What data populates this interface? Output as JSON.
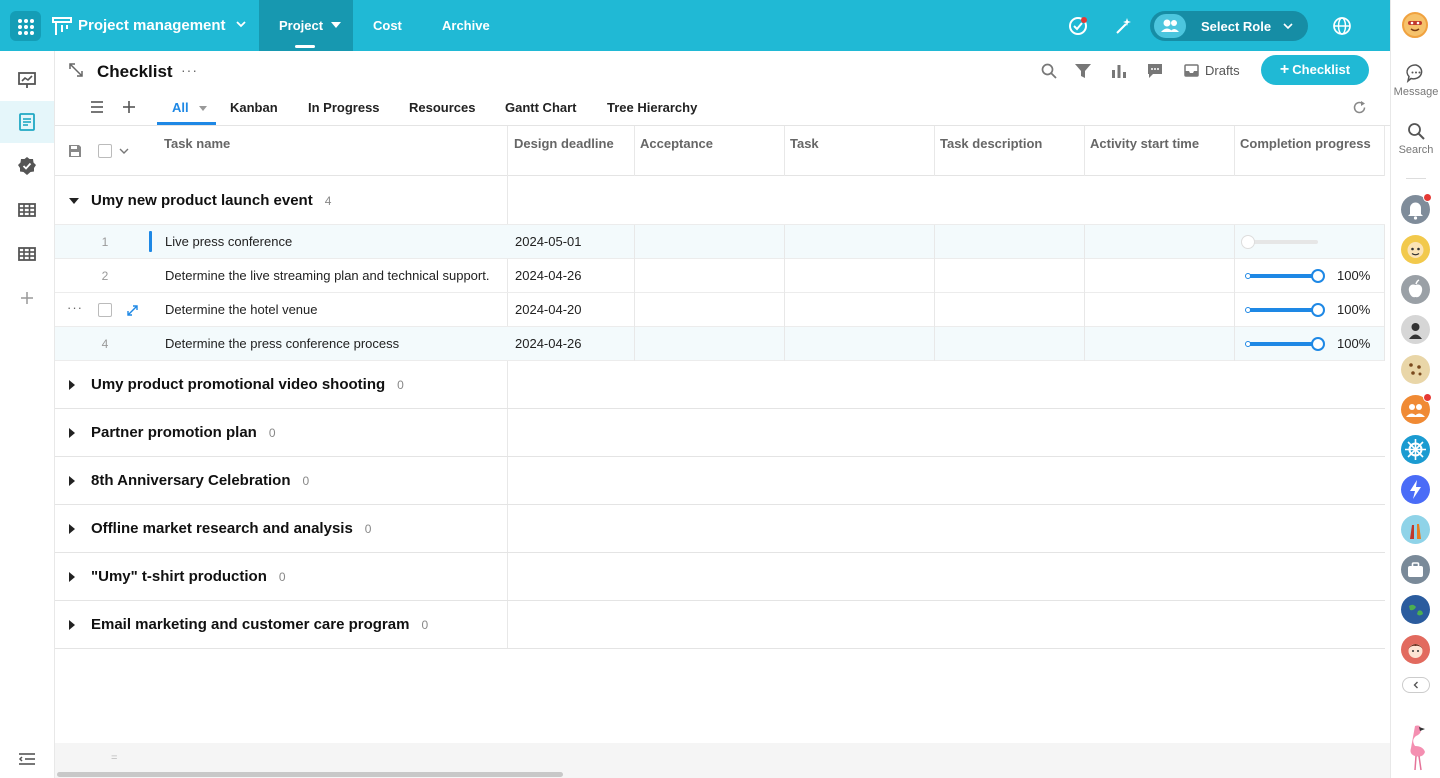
{
  "topbar": {
    "app_title": "Project management",
    "nav_tabs": [
      {
        "label": "Project",
        "active": true
      },
      {
        "label": "Cost",
        "active": false
      },
      {
        "label": "Archive",
        "active": false
      }
    ],
    "role_label": "Select Role",
    "icons": [
      "apps-grid-icon",
      "project-logo-icon",
      "chevron-down-icon",
      "check-badge-icon",
      "magic-wand-icon",
      "people-icon",
      "globe-icon"
    ],
    "accent_color": "#20b9d5"
  },
  "leftbar": {
    "items": [
      {
        "icon": "presentation-chart-icon",
        "active": false
      },
      {
        "icon": "document-list-icon",
        "active": true
      },
      {
        "icon": "verified-badge-icon",
        "active": false
      },
      {
        "icon": "table-grid-icon",
        "active": false
      },
      {
        "icon": "table-grid-icon",
        "active": false
      },
      {
        "icon": "plus-icon",
        "active": false
      }
    ],
    "bottom_icon": "collapse-menu-icon"
  },
  "header": {
    "title": "Checklist",
    "more": "···",
    "drafts_label": "Drafts",
    "new_button_label": "Checklist",
    "tool_icons": [
      "search-icon",
      "filter-icon",
      "bar-chart-icon",
      "comment-icon",
      "drafts-icon"
    ]
  },
  "view_tabs": [
    {
      "label": "All",
      "active": true
    },
    {
      "label": "Kanban",
      "active": false
    },
    {
      "label": "In Progress",
      "active": false
    },
    {
      "label": "Resources",
      "active": false
    },
    {
      "label": "Gantt Chart",
      "active": false
    },
    {
      "label": "Tree Hierarchy",
      "active": false
    }
  ],
  "table": {
    "columns": [
      "Task name",
      "Design deadline",
      "Acceptance",
      "Task",
      "Task description",
      "Activity start time",
      "Completion progress"
    ],
    "groups": [
      {
        "title": "Umy new product launch event",
        "count": "4",
        "expanded": true,
        "rows": [
          {
            "num": "1",
            "name": "Live press conference",
            "deadline": "2024-05-01",
            "progress": 0,
            "progress_text": ""
          },
          {
            "num": "2",
            "name": "Determine the live streaming plan and technical support.",
            "deadline": "2024-04-26",
            "progress": 1,
            "progress_text": "100%"
          },
          {
            "num": "",
            "name": "Determine the hotel venue",
            "deadline": "2024-04-20",
            "progress": 1,
            "progress_text": "100%"
          },
          {
            "num": "4",
            "name": "Determine the press conference process",
            "deadline": "2024-04-26",
            "progress": 1,
            "progress_text": "100%"
          }
        ]
      },
      {
        "title": "Umy product promotional video shooting",
        "count": "0",
        "expanded": false
      },
      {
        "title": "Partner promotion plan",
        "count": "0",
        "expanded": false
      },
      {
        "title": "8th Anniversary Celebration",
        "count": "0",
        "expanded": false
      },
      {
        "title": "Offline market research and analysis",
        "count": "0",
        "expanded": false
      },
      {
        "title": "\"Umy\" t-shirt production",
        "count": "0",
        "expanded": false
      },
      {
        "title": "Email marketing and customer care program",
        "count": "0",
        "expanded": false
      }
    ],
    "progress_color": "#1e88e5"
  },
  "footer": {
    "handle": "="
  },
  "rightbar": {
    "message_label": "Message",
    "search_label": "Search",
    "apps": [
      {
        "icon": "bell-icon",
        "color": "#7f8c9a",
        "badge": true
      },
      {
        "icon": "cartoon-avatar-icon",
        "color": "#f2c94c",
        "badge": false
      },
      {
        "icon": "apple-icon",
        "color": "#9aa0a6",
        "badge": false
      },
      {
        "icon": "character-icon",
        "color": "#d6d6d6",
        "badge": false
      },
      {
        "icon": "cookie-icon",
        "color": "#e9d6a8",
        "badge": false
      },
      {
        "icon": "team-icon",
        "color": "#f08a34",
        "badge": true
      },
      {
        "icon": "ship-wheel-icon",
        "color": "#1b9bd1",
        "badge": false
      },
      {
        "icon": "lightning-icon",
        "color": "#4a6cf7",
        "badge": false
      },
      {
        "icon": "hands-icon",
        "color": "#8fd3e8",
        "badge": false
      },
      {
        "icon": "briefcase-icon",
        "color": "#7a8a99",
        "badge": false
      },
      {
        "icon": "earth-icon",
        "color": "#2b5c9e",
        "badge": false
      },
      {
        "icon": "face-avatar-icon",
        "color": "#e26a5e",
        "badge": false
      }
    ],
    "collapse_icon": "chevron-left-icon",
    "bottom_icon": "flamingo-icon"
  }
}
